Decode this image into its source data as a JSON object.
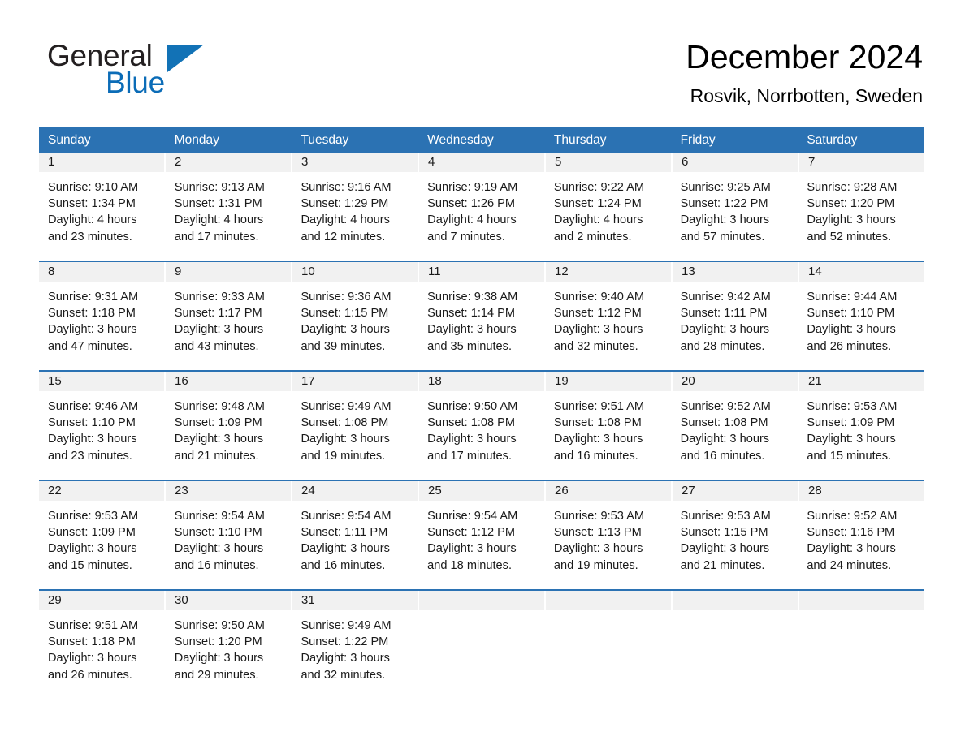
{
  "brand": {
    "name_part1": "General",
    "name_part2": "Blue"
  },
  "header": {
    "month_title": "December 2024",
    "location": "Rosvik, Norrbotten, Sweden"
  },
  "theme": {
    "header_blue": "#2b72b3",
    "date_band_gray": "#f1f1f1",
    "logo_blue": "#0b6cb7",
    "text_black": "#1a1a1a"
  },
  "weekdays": [
    "Sunday",
    "Monday",
    "Tuesday",
    "Wednesday",
    "Thursday",
    "Friday",
    "Saturday"
  ],
  "weeks": [
    {
      "days": [
        {
          "date": "1",
          "sunrise": "Sunrise: 9:10 AM",
          "sunset": "Sunset: 1:34 PM",
          "daylight_line1": "Daylight: 4 hours",
          "daylight_line2": "and 23 minutes."
        },
        {
          "date": "2",
          "sunrise": "Sunrise: 9:13 AM",
          "sunset": "Sunset: 1:31 PM",
          "daylight_line1": "Daylight: 4 hours",
          "daylight_line2": "and 17 minutes."
        },
        {
          "date": "3",
          "sunrise": "Sunrise: 9:16 AM",
          "sunset": "Sunset: 1:29 PM",
          "daylight_line1": "Daylight: 4 hours",
          "daylight_line2": "and 12 minutes."
        },
        {
          "date": "4",
          "sunrise": "Sunrise: 9:19 AM",
          "sunset": "Sunset: 1:26 PM",
          "daylight_line1": "Daylight: 4 hours",
          "daylight_line2": "and 7 minutes."
        },
        {
          "date": "5",
          "sunrise": "Sunrise: 9:22 AM",
          "sunset": "Sunset: 1:24 PM",
          "daylight_line1": "Daylight: 4 hours",
          "daylight_line2": "and 2 minutes."
        },
        {
          "date": "6",
          "sunrise": "Sunrise: 9:25 AM",
          "sunset": "Sunset: 1:22 PM",
          "daylight_line1": "Daylight: 3 hours",
          "daylight_line2": "and 57 minutes."
        },
        {
          "date": "7",
          "sunrise": "Sunrise: 9:28 AM",
          "sunset": "Sunset: 1:20 PM",
          "daylight_line1": "Daylight: 3 hours",
          "daylight_line2": "and 52 minutes."
        }
      ]
    },
    {
      "days": [
        {
          "date": "8",
          "sunrise": "Sunrise: 9:31 AM",
          "sunset": "Sunset: 1:18 PM",
          "daylight_line1": "Daylight: 3 hours",
          "daylight_line2": "and 47 minutes."
        },
        {
          "date": "9",
          "sunrise": "Sunrise: 9:33 AM",
          "sunset": "Sunset: 1:17 PM",
          "daylight_line1": "Daylight: 3 hours",
          "daylight_line2": "and 43 minutes."
        },
        {
          "date": "10",
          "sunrise": "Sunrise: 9:36 AM",
          "sunset": "Sunset: 1:15 PM",
          "daylight_line1": "Daylight: 3 hours",
          "daylight_line2": "and 39 minutes."
        },
        {
          "date": "11",
          "sunrise": "Sunrise: 9:38 AM",
          "sunset": "Sunset: 1:14 PM",
          "daylight_line1": "Daylight: 3 hours",
          "daylight_line2": "and 35 minutes."
        },
        {
          "date": "12",
          "sunrise": "Sunrise: 9:40 AM",
          "sunset": "Sunset: 1:12 PM",
          "daylight_line1": "Daylight: 3 hours",
          "daylight_line2": "and 32 minutes."
        },
        {
          "date": "13",
          "sunrise": "Sunrise: 9:42 AM",
          "sunset": "Sunset: 1:11 PM",
          "daylight_line1": "Daylight: 3 hours",
          "daylight_line2": "and 28 minutes."
        },
        {
          "date": "14",
          "sunrise": "Sunrise: 9:44 AM",
          "sunset": "Sunset: 1:10 PM",
          "daylight_line1": "Daylight: 3 hours",
          "daylight_line2": "and 26 minutes."
        }
      ]
    },
    {
      "days": [
        {
          "date": "15",
          "sunrise": "Sunrise: 9:46 AM",
          "sunset": "Sunset: 1:10 PM",
          "daylight_line1": "Daylight: 3 hours",
          "daylight_line2": "and 23 minutes."
        },
        {
          "date": "16",
          "sunrise": "Sunrise: 9:48 AM",
          "sunset": "Sunset: 1:09 PM",
          "daylight_line1": "Daylight: 3 hours",
          "daylight_line2": "and 21 minutes."
        },
        {
          "date": "17",
          "sunrise": "Sunrise: 9:49 AM",
          "sunset": "Sunset: 1:08 PM",
          "daylight_line1": "Daylight: 3 hours",
          "daylight_line2": "and 19 minutes."
        },
        {
          "date": "18",
          "sunrise": "Sunrise: 9:50 AM",
          "sunset": "Sunset: 1:08 PM",
          "daylight_line1": "Daylight: 3 hours",
          "daylight_line2": "and 17 minutes."
        },
        {
          "date": "19",
          "sunrise": "Sunrise: 9:51 AM",
          "sunset": "Sunset: 1:08 PM",
          "daylight_line1": "Daylight: 3 hours",
          "daylight_line2": "and 16 minutes."
        },
        {
          "date": "20",
          "sunrise": "Sunrise: 9:52 AM",
          "sunset": "Sunset: 1:08 PM",
          "daylight_line1": "Daylight: 3 hours",
          "daylight_line2": "and 16 minutes."
        },
        {
          "date": "21",
          "sunrise": "Sunrise: 9:53 AM",
          "sunset": "Sunset: 1:09 PM",
          "daylight_line1": "Daylight: 3 hours",
          "daylight_line2": "and 15 minutes."
        }
      ]
    },
    {
      "days": [
        {
          "date": "22",
          "sunrise": "Sunrise: 9:53 AM",
          "sunset": "Sunset: 1:09 PM",
          "daylight_line1": "Daylight: 3 hours",
          "daylight_line2": "and 15 minutes."
        },
        {
          "date": "23",
          "sunrise": "Sunrise: 9:54 AM",
          "sunset": "Sunset: 1:10 PM",
          "daylight_line1": "Daylight: 3 hours",
          "daylight_line2": "and 16 minutes."
        },
        {
          "date": "24",
          "sunrise": "Sunrise: 9:54 AM",
          "sunset": "Sunset: 1:11 PM",
          "daylight_line1": "Daylight: 3 hours",
          "daylight_line2": "and 16 minutes."
        },
        {
          "date": "25",
          "sunrise": "Sunrise: 9:54 AM",
          "sunset": "Sunset: 1:12 PM",
          "daylight_line1": "Daylight: 3 hours",
          "daylight_line2": "and 18 minutes."
        },
        {
          "date": "26",
          "sunrise": "Sunrise: 9:53 AM",
          "sunset": "Sunset: 1:13 PM",
          "daylight_line1": "Daylight: 3 hours",
          "daylight_line2": "and 19 minutes."
        },
        {
          "date": "27",
          "sunrise": "Sunrise: 9:53 AM",
          "sunset": "Sunset: 1:15 PM",
          "daylight_line1": "Daylight: 3 hours",
          "daylight_line2": "and 21 minutes."
        },
        {
          "date": "28",
          "sunrise": "Sunrise: 9:52 AM",
          "sunset": "Sunset: 1:16 PM",
          "daylight_line1": "Daylight: 3 hours",
          "daylight_line2": "and 24 minutes."
        }
      ]
    },
    {
      "days": [
        {
          "date": "29",
          "sunrise": "Sunrise: 9:51 AM",
          "sunset": "Sunset: 1:18 PM",
          "daylight_line1": "Daylight: 3 hours",
          "daylight_line2": "and 26 minutes."
        },
        {
          "date": "30",
          "sunrise": "Sunrise: 9:50 AM",
          "sunset": "Sunset: 1:20 PM",
          "daylight_line1": "Daylight: 3 hours",
          "daylight_line2": "and 29 minutes."
        },
        {
          "date": "31",
          "sunrise": "Sunrise: 9:49 AM",
          "sunset": "Sunset: 1:22 PM",
          "daylight_line1": "Daylight: 3 hours",
          "daylight_line2": "and 32 minutes."
        },
        {
          "date": "",
          "sunrise": "",
          "sunset": "",
          "daylight_line1": "",
          "daylight_line2": ""
        },
        {
          "date": "",
          "sunrise": "",
          "sunset": "",
          "daylight_line1": "",
          "daylight_line2": ""
        },
        {
          "date": "",
          "sunrise": "",
          "sunset": "",
          "daylight_line1": "",
          "daylight_line2": ""
        },
        {
          "date": "",
          "sunrise": "",
          "sunset": "",
          "daylight_line1": "",
          "daylight_line2": ""
        }
      ]
    }
  ]
}
